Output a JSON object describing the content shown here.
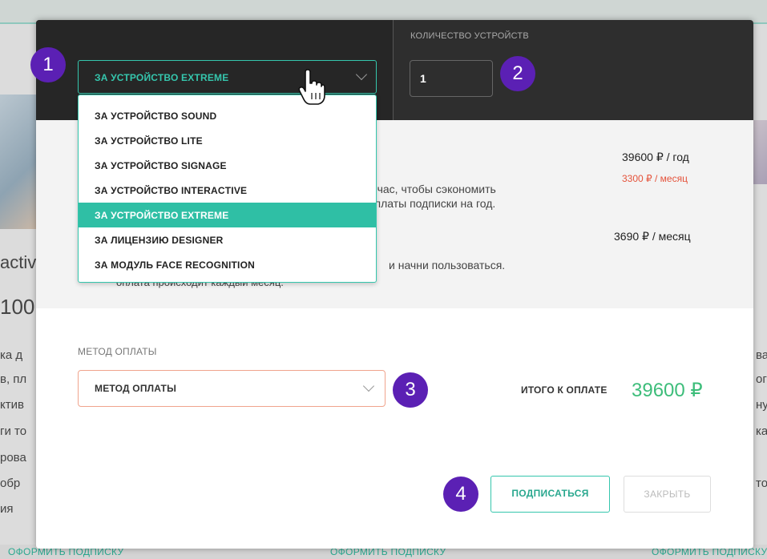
{
  "background": {
    "left_fragments": [
      "activ",
      "100",
      "ка д",
      "в, пл",
      "ктив",
      "ги то",
      "рова",
      "обр",
      "ия"
    ],
    "right_fragments": [
      "ва",
      "ог",
      "нут",
      "ка",
      "то"
    ],
    "bottom_links": [
      "ОФОРМИТЬ ПОДПИСКУ",
      "ОФОРМИТЬ ПОДПИСКУ",
      "ОФОРМИТЬ ПОДПИСКУ"
    ]
  },
  "modal": {
    "plan_select": {
      "value": "ЗА УСТРОЙСТВО EXTREME",
      "options": [
        "ЗА УСТРОЙСТВО SOUND",
        "ЗА УСТРОЙСТВО LITE",
        "ЗА УСТРОЙСТВО SIGNAGE",
        "ЗА УСТРОЙСТВО INTERACTIVE",
        "ЗА УСТРОЙСТВО EXTREME",
        "ЗА ЛИЦЕНЗИЮ DESIGNER",
        "ЗА МОДУЛЬ FACE RECOGNITION"
      ],
      "selected_index": 4
    },
    "quantity": {
      "label": "КОЛИЧЕСТВО УСТРОЙСТВ",
      "value": "1"
    },
    "info": {
      "annual_text_1": "сейчас, чтобы сэкономить",
      "annual_text_2": "и оплаты подписки на год.",
      "annual_price": "39600 ₽ / год",
      "annual_monthly": "3300 ₽ / месяц",
      "monthly_price": "3690 ₽ / месяц",
      "monthly_text_1": "и начни пользоваться.",
      "monthly_text_2": "оплата происходит каждый месяц."
    },
    "payment": {
      "label": "МЕТОД ОПЛАТЫ",
      "value": "МЕТОД ОПЛАТЫ"
    },
    "total": {
      "label": "ИТОГО К ОПЛАТЕ",
      "value": "39600 ₽"
    },
    "buttons": {
      "subscribe": "ПОДПИСАТЬСЯ",
      "close": "ЗАКРЫТЬ"
    }
  },
  "badges": [
    "1",
    "2",
    "3",
    "4"
  ],
  "colors": {
    "accent": "#35c6ad",
    "badge": "#5b20b4",
    "total": "#3dbd7a",
    "discount": "#e5533b"
  }
}
